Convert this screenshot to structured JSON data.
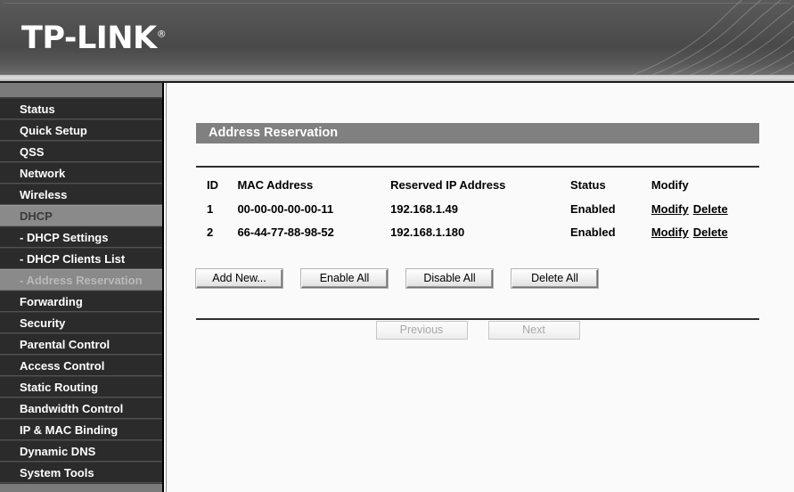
{
  "brand": {
    "name": "TP-LINK",
    "trademark": "®"
  },
  "sidebar": {
    "items": [
      {
        "label": "Status",
        "state": "normal"
      },
      {
        "label": "Quick Setup",
        "state": "normal"
      },
      {
        "label": "QSS",
        "state": "normal"
      },
      {
        "label": "Network",
        "state": "normal"
      },
      {
        "label": "Wireless",
        "state": "normal"
      },
      {
        "label": "DHCP",
        "state": "expanded"
      },
      {
        "label": "- DHCP Settings",
        "state": "sub"
      },
      {
        "label": "- DHCP Clients List",
        "state": "sub"
      },
      {
        "label": "- Address Reservation",
        "state": "sub-active"
      },
      {
        "label": "Forwarding",
        "state": "normal"
      },
      {
        "label": "Security",
        "state": "normal"
      },
      {
        "label": "Parental Control",
        "state": "normal"
      },
      {
        "label": "Access Control",
        "state": "normal"
      },
      {
        "label": "Static Routing",
        "state": "normal"
      },
      {
        "label": "Bandwidth Control",
        "state": "normal"
      },
      {
        "label": "IP & MAC Binding",
        "state": "normal"
      },
      {
        "label": "Dynamic DNS",
        "state": "normal"
      },
      {
        "label": "System Tools",
        "state": "normal"
      }
    ]
  },
  "main": {
    "title": "Address Reservation",
    "table": {
      "headers": [
        "ID",
        "MAC Address",
        "Reserved IP Address",
        "Status",
        "Modify"
      ],
      "rows": [
        {
          "id": "1",
          "mac": "00-00-00-00-00-11",
          "ip": "192.168.1.49",
          "status": "Enabled",
          "modify": "Modify",
          "delete": "Delete"
        },
        {
          "id": "2",
          "mac": "66-44-77-88-98-52",
          "ip": "192.168.1.180",
          "status": "Enabled",
          "modify": "Modify",
          "delete": "Delete"
        }
      ]
    },
    "buttons": {
      "add_new": "Add New...",
      "enable_all": "Enable All",
      "disable_all": "Disable All",
      "delete_all": "Delete All"
    },
    "pager": {
      "previous": "Previous",
      "next": "Next"
    }
  },
  "colors": {
    "title_bar": "#808080",
    "sidebar_bg": "#2b2b2b",
    "sidebar_highlight": "#8a8a8a",
    "header_bg": "#4e4e4e"
  }
}
